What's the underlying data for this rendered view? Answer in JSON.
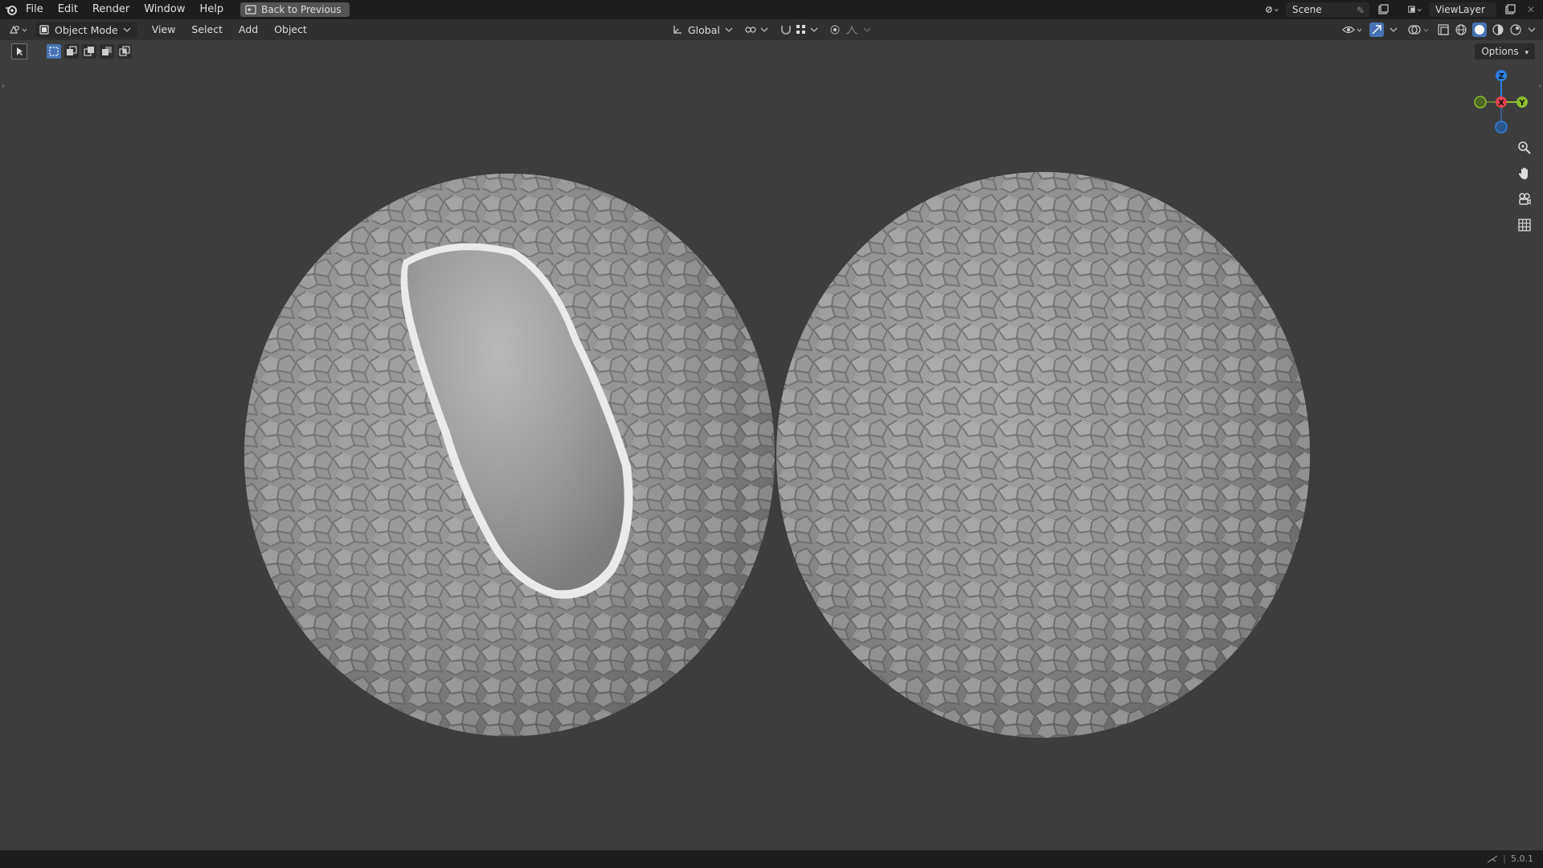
{
  "menu": {
    "items": [
      "File",
      "Edit",
      "Render",
      "Window",
      "Help"
    ],
    "back_label": "Back to Previous"
  },
  "topright": {
    "scene": "Scene",
    "view_layer": "ViewLayer"
  },
  "header": {
    "mode": "Object Mode",
    "menus": [
      "View",
      "Select",
      "Add",
      "Object"
    ],
    "transform_orientation": "Global"
  },
  "toolbar": {
    "options_label": "Options"
  },
  "gizmo": {
    "z": "Z",
    "y": "Y",
    "x": "X",
    "colors": {
      "x": "#e8434f",
      "y": "#8cbf2f",
      "z": "#2f7fe0"
    }
  },
  "status": {
    "version": "5.0.1"
  },
  "colors": {
    "topbar": "#1d1d1d",
    "header": "#303030",
    "viewport": "#3d3d3d",
    "mesh_base": "#8c8c8c"
  }
}
